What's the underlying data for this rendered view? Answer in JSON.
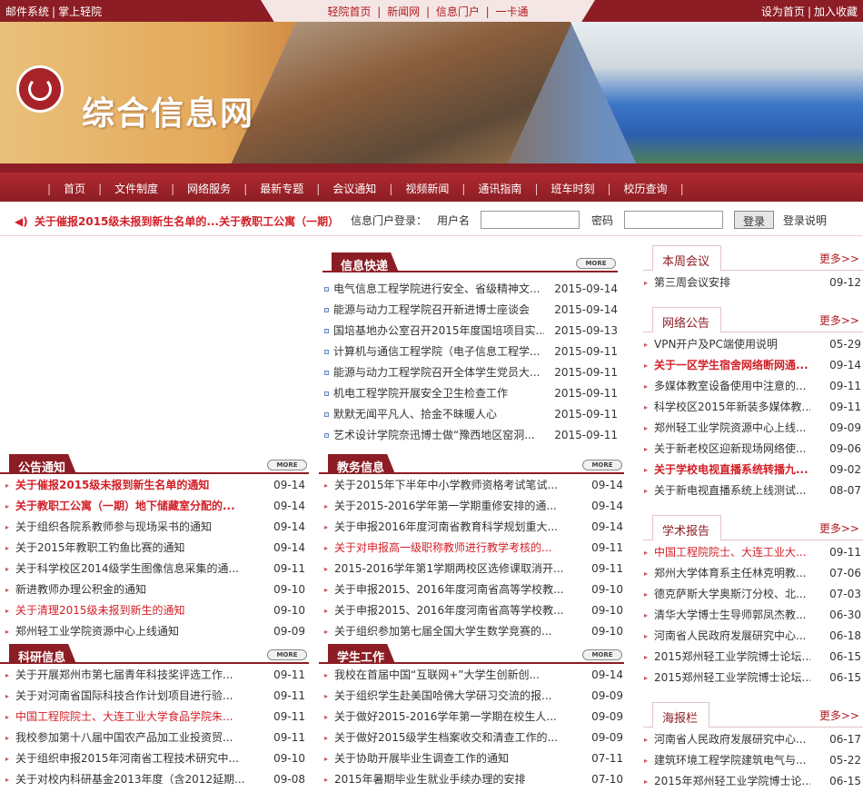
{
  "topbar": {
    "left": [
      "邮件系统",
      "掌上轻院"
    ],
    "center": [
      "轻院首页",
      "新闻网",
      "信息门户",
      "一卡通"
    ],
    "right": [
      "设为首页",
      "加入收藏"
    ]
  },
  "banner": {
    "title": "综合信息网",
    "logo_icon": "university-seal-icon"
  },
  "nav": [
    "首页",
    "文件制度",
    "网络服务",
    "最新专题",
    "会议通知",
    "视频新闻",
    "通讯指南",
    "班车时刻",
    "校历查询"
  ],
  "marquee": {
    "icon": "speaker-icon",
    "text": "关于催报2015级未报到新生名单的...关于教职工公寓（一期）"
  },
  "login": {
    "label": "信息门户登录：",
    "user_label": "用户名",
    "pass_label": "密码",
    "button": "登录",
    "help": "登录说明"
  },
  "more_label": "MORE",
  "right_more": "更多>>",
  "xinxi": {
    "title": "信息快递",
    "items": [
      {
        "t": "电气信息工程学院进行安全、省级精神文...",
        "d": "2015-09-14"
      },
      {
        "t": "能源与动力工程学院召开新进博士座谈会",
        "d": "2015-09-14"
      },
      {
        "t": "国培基地办公室召开2015年度国培项目实...",
        "d": "2015-09-13"
      },
      {
        "t": "计算机与通信工程学院（电子信息工程学...",
        "d": "2015-09-11"
      },
      {
        "t": "能源与动力工程学院召开全体学生党员大...",
        "d": "2015-09-11"
      },
      {
        "t": "机电工程学院开展安全卫生检查工作",
        "d": "2015-09-11"
      },
      {
        "t": "默默无闻平凡人、拾金不昧暖人心",
        "d": "2015-09-11"
      },
      {
        "t": "艺术设计学院奈迅博士做“豫西地区窑洞...",
        "d": "2015-09-11"
      }
    ]
  },
  "gonggao": {
    "title": "公告通知",
    "items": [
      {
        "t": "关于催报2015级未报到新生名单的通知",
        "d": "09-14",
        "s": "red"
      },
      {
        "t": "关于教职工公寓（一期）地下储藏室分配的...",
        "d": "09-14",
        "s": "red"
      },
      {
        "t": "关于组织各院系教师参与现场采书的通知",
        "d": "09-14",
        "s": ""
      },
      {
        "t": "关于2015年教职工钓鱼比赛的通知",
        "d": "09-14",
        "s": ""
      },
      {
        "t": "关于科学校区2014级学生图像信息采集的通...",
        "d": "09-11",
        "s": ""
      },
      {
        "t": "新进教师办理公积金的通知",
        "d": "09-10",
        "s": ""
      },
      {
        "t": "关于清理2015级未报到新生的通知",
        "d": "09-10",
        "s": "red2"
      },
      {
        "t": "郑州轻工业学院资源中心上线通知",
        "d": "09-09",
        "s": ""
      }
    ]
  },
  "jiaowu": {
    "title": "教务信息",
    "items": [
      {
        "t": "关于2015年下半年中小学教师资格考试笔试...",
        "d": "09-14",
        "s": ""
      },
      {
        "t": "关于2015-2016学年第一学期重修安排的通...",
        "d": "09-14",
        "s": ""
      },
      {
        "t": "关于申报2016年度河南省教育科学规划重大...",
        "d": "09-14",
        "s": ""
      },
      {
        "t": "关于对申报高一级职称教师进行教学考核的...",
        "d": "09-11",
        "s": "red2"
      },
      {
        "t": "2015-2016学年第1学期两校区选修课取消开...",
        "d": "09-11",
        "s": ""
      },
      {
        "t": "关于申报2015、2016年度河南省高等学校教...",
        "d": "09-10",
        "s": ""
      },
      {
        "t": "关于申报2015、2016年度河南省高等学校教...",
        "d": "09-10",
        "s": ""
      },
      {
        "t": "关于组织参加第七届全国大学生数学竞赛的...",
        "d": "09-10",
        "s": ""
      }
    ]
  },
  "keyan": {
    "title": "科研信息",
    "items": [
      {
        "t": "关于开展郑州市第七届青年科技奖评选工作...",
        "d": "09-11",
        "s": ""
      },
      {
        "t": "关于对河南省国际科技合作计划项目进行验...",
        "d": "09-11",
        "s": ""
      },
      {
        "t": "中国工程院院士、大连工业大学食品学院朱...",
        "d": "09-11",
        "s": "red2"
      },
      {
        "t": "我校参加第十八届中国农产品加工业投资贸...",
        "d": "09-11",
        "s": ""
      },
      {
        "t": "关于组织申报2015年河南省工程技术研究中...",
        "d": "09-10",
        "s": ""
      },
      {
        "t": "关于对校内科研基金2013年度（含2012延期...",
        "d": "09-08",
        "s": ""
      }
    ]
  },
  "xuesheng": {
    "title": "学生工作",
    "items": [
      {
        "t": "我校在首届中国“互联网+”大学生创新创...",
        "d": "09-14",
        "s": ""
      },
      {
        "t": "关于组织学生赴美国哈佛大学研习交流的报...",
        "d": "09-09",
        "s": ""
      },
      {
        "t": "关于做好2015-2016学年第一学期在校生人...",
        "d": "09-09",
        "s": ""
      },
      {
        "t": "关于做好2015级学生档案收交和清查工作的...",
        "d": "09-09",
        "s": ""
      },
      {
        "t": "关于协助开展毕业生调查工作的通知",
        "d": "07-11",
        "s": ""
      },
      {
        "t": "2015年暑期毕业生就业手续办理的安排",
        "d": "07-10",
        "s": ""
      }
    ]
  },
  "huiyi": {
    "title": "本周会议",
    "items": [
      {
        "t": "第三周会议安排",
        "d": "09-12",
        "s": ""
      }
    ]
  },
  "wangluo": {
    "title": "网络公告",
    "items": [
      {
        "t": "VPN开户及PC端使用说明",
        "d": "05-29",
        "s": ""
      },
      {
        "t": "关于一区学生宿舍网络断网通...",
        "d": "09-14",
        "s": "red"
      },
      {
        "t": "多媒体教室设备使用中注意的...",
        "d": "09-11",
        "s": ""
      },
      {
        "t": "科学校区2015年新装多媒体教...",
        "d": "09-11",
        "s": ""
      },
      {
        "t": "郑州轻工业学院资源中心上线...",
        "d": "09-09",
        "s": ""
      },
      {
        "t": "关于新老校区迎新现场网络使...",
        "d": "09-06",
        "s": ""
      },
      {
        "t": "关于学校电视直播系统转播九...",
        "d": "09-02",
        "s": "red"
      },
      {
        "t": "关于新电视直播系统上线测试...",
        "d": "08-07",
        "s": ""
      }
    ]
  },
  "xueshu": {
    "title": "学术报告",
    "items": [
      {
        "t": "中国工程院院士、大连工业大...",
        "d": "09-11",
        "s": "red2"
      },
      {
        "t": "郑州大学体育系主任林克明教...",
        "d": "07-06",
        "s": ""
      },
      {
        "t": "德克萨斯大学奥斯汀分校、北...",
        "d": "07-03",
        "s": ""
      },
      {
        "t": "清华大学博士生导师郭凤杰教...",
        "d": "06-30",
        "s": ""
      },
      {
        "t": "河南省人民政府发展研究中心...",
        "d": "06-18",
        "s": ""
      },
      {
        "t": "2015郑州轻工业学院博士论坛...",
        "d": "06-15",
        "s": ""
      },
      {
        "t": "2015郑州轻工业学院博士论坛...",
        "d": "06-15",
        "s": ""
      }
    ]
  },
  "haibao": {
    "title": "海报栏",
    "items": [
      {
        "t": "河南省人民政府发展研究中心...",
        "d": "06-17",
        "s": ""
      },
      {
        "t": "建筑环境工程学院建筑电气与...",
        "d": "05-22",
        "s": ""
      },
      {
        "t": "2015年郑州轻工业学院博士论...",
        "d": "06-15",
        "s": ""
      }
    ]
  }
}
